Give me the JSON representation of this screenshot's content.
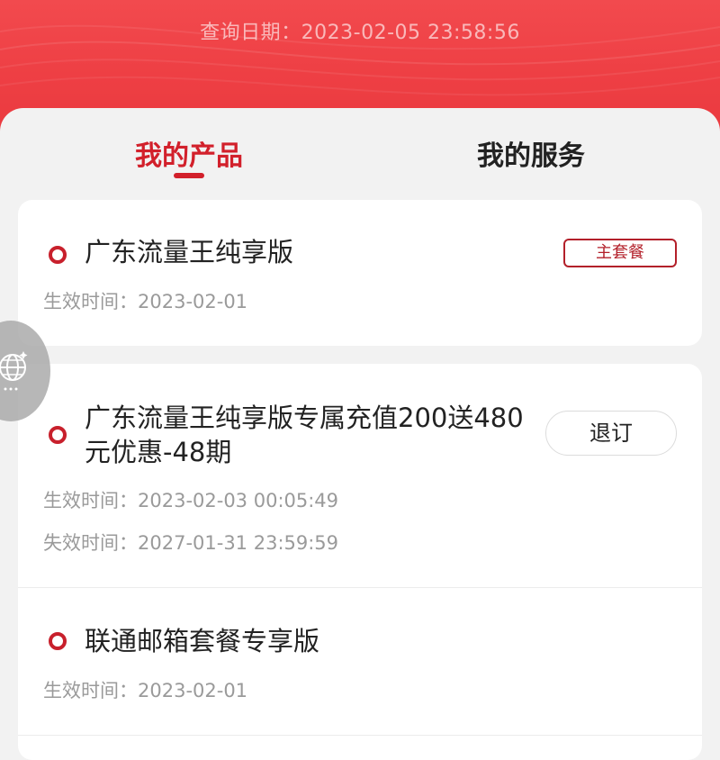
{
  "header": {
    "query_date": "查询日期：2023-02-05 23:58:56",
    "background_color": "#ee3f44"
  },
  "tabs": [
    {
      "label": "我的产品",
      "active": true
    },
    {
      "label": "我的服务",
      "active": false
    }
  ],
  "accent_color": "#d2202b",
  "products": [
    {
      "title": "广东流量王纯享版",
      "badge": "主套餐",
      "effective": "生效时间：2023-02-01"
    },
    {
      "title_line1": "广东流量王纯享版专属充值200送480",
      "title_line2": "元优惠-48期",
      "action": "退订",
      "effective": "生效时间：2023-02-03 00:05:49",
      "expires": "失效时间：2027-01-31 23:59:59"
    },
    {
      "title": "联通邮箱套餐专享版",
      "effective": "生效时间：2023-02-01"
    }
  ],
  "floating_button": {
    "icon": "globe-icon"
  }
}
